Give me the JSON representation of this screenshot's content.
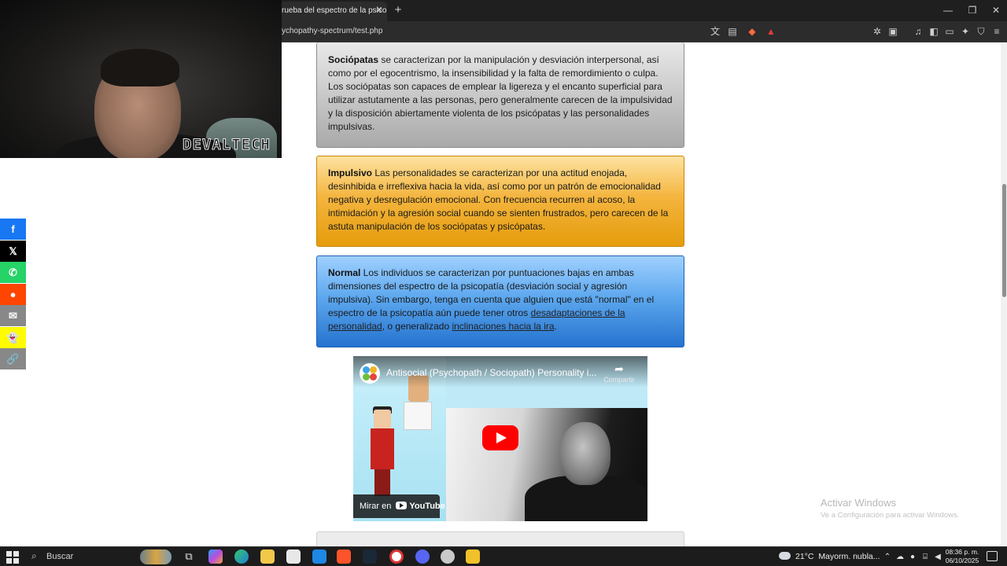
{
  "browser": {
    "tab_title": "rueba del espectro de la psicop",
    "tab_close": "✕",
    "new_tab": "+",
    "url": "ychopathy-spectrum/test.php",
    "window_controls": {
      "minimize": "—",
      "restore": "❐",
      "close": "✕"
    }
  },
  "webcam": {
    "overlay_text": "DEVALTECH"
  },
  "share_bar": {
    "buttons": [
      {
        "network": "facebook",
        "glyph": "f",
        "color": "#1877f2"
      },
      {
        "network": "x",
        "glyph": "𝕏",
        "color": "#000000"
      },
      {
        "network": "whatsapp",
        "glyph": "✆",
        "color": "#25d366"
      },
      {
        "network": "reddit",
        "glyph": "●",
        "color": "#ff4500"
      },
      {
        "network": "email",
        "glyph": "✉",
        "color": "#888888"
      },
      {
        "network": "snapchat",
        "glyph": "👻",
        "color": "#fffc00"
      },
      {
        "network": "copy-link",
        "glyph": "🔗",
        "color": "#888888"
      }
    ]
  },
  "cards": {
    "sociopatas": {
      "heading": "Sociópatas",
      "text": " se caracterizan por la manipulación y desviación interpersonal, así como por el egocentrismo, la insensibilidad y la falta de remordimiento o culpa. Los sociópatas son capaces de emplear la ligereza y el encanto superficial para utilizar astutamente a las personas, pero generalmente carecen de la impulsividad y la disposición abiertamente violenta de los psicópatas y las personalidades impulsivas.",
      "color": "#b5b5b5"
    },
    "impulsivo": {
      "heading": "Impulsivo",
      "text": " Las personalidades se caracterizan por una actitud enojada, desinhibida e irreflexiva hacia la vida, así como por un patrón de emocionalidad negativa y desregulación emocional. Con frecuencia recurren al acoso, la intimidación y la agresión social cuando se sienten frustrados, pero carecen de la astuta manipulación de los sociópatas y psicópatas.",
      "color": "#e9a31a"
    },
    "normal": {
      "heading": "Normal",
      "text_1": " Los individuos se caracterizan por puntuaciones bajas en ambas dimensiones del espectro de la psicopatía (desviación social y agresión impulsiva). Sin embargo, tenga en cuenta que alguien que está \"normal\" en el espectro de la psicopatía aún puede tener otros ",
      "link_1": "desadaptaciones de la personalidad",
      "text_2": ", o generalizado ",
      "link_2": "inclinaciones hacia la ira",
      "text_3": ".",
      "color": "#3c8ae0"
    }
  },
  "video": {
    "title": "Antisocial (Psychopath / Sociopath) Personality i...",
    "share_label": "Compartir",
    "watch_on": "Mirar en",
    "youtube_label": "YouTube"
  },
  "watermark": {
    "title": "Activar Windows",
    "subtitle": "Ve a Configuración para activar Windows."
  },
  "taskbar": {
    "search_label": "Buscar",
    "weather_temp": "21°C",
    "weather_text": "Mayorm. nubla...",
    "time": "08:36 p. m.",
    "date": "06/10/2025"
  }
}
